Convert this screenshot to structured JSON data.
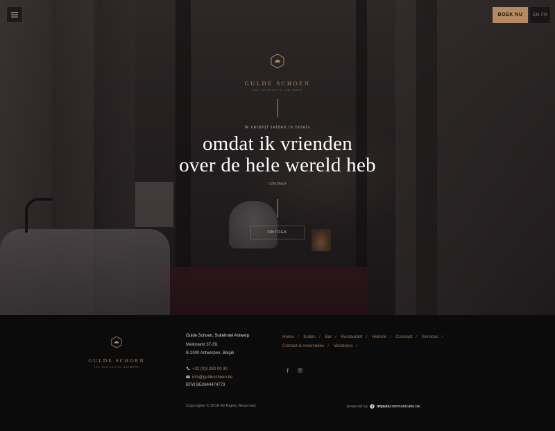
{
  "header": {
    "menu_icon": "hamburger-icon",
    "book_label": "BOEK NU",
    "languages": [
      "EN",
      "FR"
    ]
  },
  "hero": {
    "logo": {
      "emblem_icon": "gulde-schoen-emblem",
      "name": "GULDE SCHOEN",
      "tagline": "THE SUITEHOTEL ANTWERP"
    },
    "quote_intro": "Ik verblijf zelden in hotels",
    "headline_line1": "omdat ik vrienden",
    "headline_line2": "over de hele wereld heb",
    "author": "Cilla Black",
    "discover_label": "ONTDEK"
  },
  "footer": {
    "logo": {
      "name": "GULDE SCHOEN",
      "tagline": "THE SUITEHOTEL ANTWERP"
    },
    "address": {
      "title": "Gulde Schoen, Suitehotel Antwerp",
      "street": "Melkmarkt 37-39,",
      "city": "B-2000 Antwerpen, België",
      "divider": "—",
      "phone": "+32 (0)3 280 00 30",
      "email": "info@guldeschoen.be",
      "vat": "BTW BE0844474773"
    },
    "nav": [
      {
        "label": "Home"
      },
      {
        "label": "Suites"
      },
      {
        "label": "Bar"
      },
      {
        "label": "Restaurant"
      },
      {
        "label": "Historie"
      },
      {
        "label": "Concept"
      },
      {
        "label": "Services"
      },
      {
        "label": "Contact & reservaties"
      },
      {
        "label": "Vacatures"
      }
    ],
    "nav_separator": "/",
    "social": [
      "facebook-icon",
      "instagram-icon"
    ],
    "copyright": "Copyrights © 2018 All Rights Reserved.",
    "powered_by": "powered by",
    "powered_brand_bold": "impuls",
    "powered_brand_rest": "communicatie.be"
  },
  "colors": {
    "accent_gold": "#b58a5f",
    "logo_gold": "#b08a63",
    "footer_bg": "#0c0b0c"
  }
}
